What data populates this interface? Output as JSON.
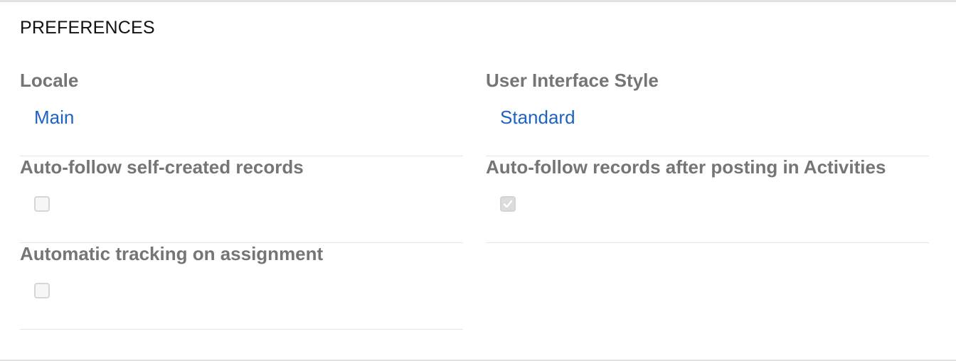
{
  "section": {
    "title": "PREFERENCES"
  },
  "fields": {
    "locale": {
      "label": "Locale",
      "value": "Main"
    },
    "ui_style": {
      "label": "User Interface Style",
      "value": "Standard"
    },
    "auto_follow_self_created": {
      "label": "Auto-follow self-created records",
      "checked": false
    },
    "auto_follow_activities": {
      "label": "Auto-follow records after posting in Activities",
      "checked": true
    },
    "automatic_tracking": {
      "label": "Automatic tracking on assignment",
      "checked": false
    }
  },
  "colors": {
    "label": "#757575",
    "link": "#1f63c1",
    "divider": "#e6e6e6",
    "checkbox_border": "#d6d6d6",
    "checkmark": "#ffffff"
  },
  "icons": {
    "checkmark": "check-icon"
  }
}
